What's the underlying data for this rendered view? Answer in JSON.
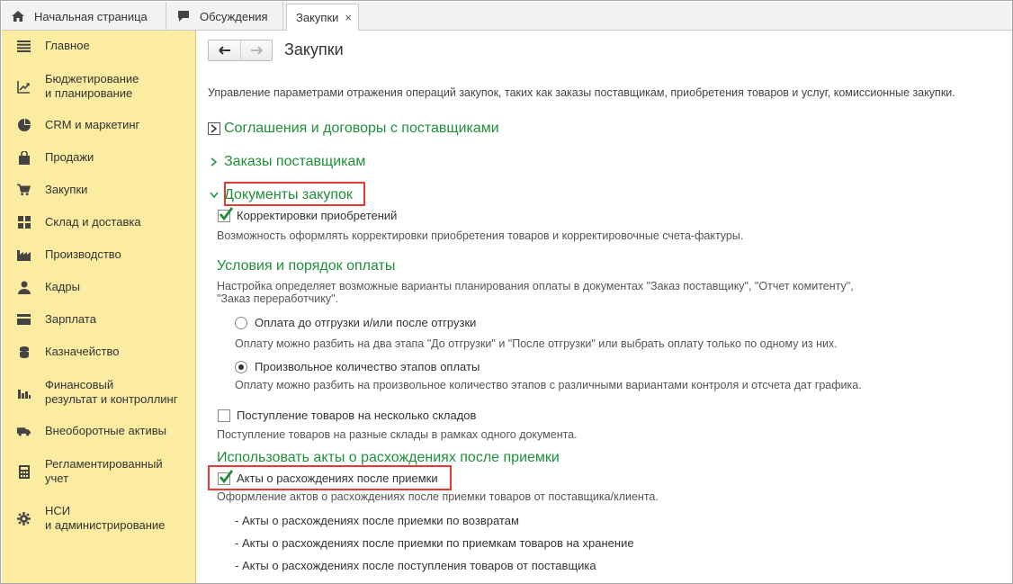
{
  "tabs": [
    {
      "label": "Начальная страница",
      "icon": "home-icon"
    },
    {
      "label": "Обсуждения",
      "icon": "discussion-icon"
    },
    {
      "label": "Закупки",
      "close": "×"
    }
  ],
  "sidebar": {
    "items": [
      {
        "label": "Главное",
        "icon": "menu-icon"
      },
      {
        "label": "Бюджетирование\nи планирование",
        "icon": "chart-growth-icon"
      },
      {
        "label": "CRM и маркетинг",
        "icon": "pie-icon"
      },
      {
        "label": "Продажи",
        "icon": "bag-icon"
      },
      {
        "label": "Закупки",
        "icon": "cart-icon"
      },
      {
        "label": "Склад и доставка",
        "icon": "warehouse-icon"
      },
      {
        "label": "Производство",
        "icon": "factory-icon"
      },
      {
        "label": "Кадры",
        "icon": "person-icon"
      },
      {
        "label": "Зарплата",
        "icon": "wallet-icon"
      },
      {
        "label": "Казначейство",
        "icon": "coins-icon"
      },
      {
        "label": "Финансовый\nрезультат и контроллинг",
        "icon": "bar-chart-icon"
      },
      {
        "label": "Внеоборотные активы",
        "icon": "truck-icon"
      },
      {
        "label": "Регламентированный\nучет",
        "icon": "calculator-icon"
      },
      {
        "label": "НСИ\nи администрирование",
        "icon": "gear-icon"
      }
    ]
  },
  "main": {
    "title": "Закупки",
    "description": "Управление параметрами отражения операций закупок, таких как заказы поставщикам, приобретения товаров и услуг, комиссионные закупки.",
    "groups": [
      {
        "label": "Соглашения и договоры с поставщиками",
        "expanded": false
      },
      {
        "label": "Заказы поставщикам",
        "expanded": false
      },
      {
        "label": "Документы закупок",
        "expanded": true
      }
    ],
    "corrections": {
      "label": "Корректировки приобретений",
      "checked": true,
      "hint": "Возможность оформлять корректировки приобретения товаров и корректировочные счета-фактуры."
    },
    "payment": {
      "heading": "Условия и порядок оплаты",
      "hint_line1": "Настройка определяет возможные варианты планирования оплаты в документах \"Заказ поставщику\", \"Отчет комитенту\",",
      "hint_line2": "\"Заказ переработчику\".",
      "options": [
        {
          "label": "Оплата до отгрузки и/или после отгрузки",
          "selected": false,
          "hint": "Оплату можно разбить на два этапа \"До отгрузки\" и \"После отгрузки\" или выбрать оплату только по одному из них."
        },
        {
          "label": "Произвольное количество этапов оплаты",
          "selected": true,
          "hint": "Оплату можно разбить на произвольное количество этапов с различными вариантами контроля и отсчета дат графика."
        }
      ]
    },
    "multi_warehouse": {
      "label": "Поступление товаров на несколько складов",
      "checked": false,
      "hint": "Поступление товаров на разные склады в рамках одного документа."
    },
    "discrepancy": {
      "heading": "Использовать акты о расхождениях после приемки",
      "label": "Акты о расхождениях после приемки",
      "checked": true,
      "hint": "Оформление актов о расхождениях после приемки товаров от поставщика/клиента.",
      "items": [
        "- Акты о расхождениях после приемки по возвратам",
        "- Акты о расхождениях после приемки по приемкам товаров на хранение",
        "- Акты о расхождениях после поступления товаров от поставщика"
      ]
    }
  },
  "colors": {
    "sidebar_bg": "#fbeca1",
    "group_green": "#1f8f3a",
    "highlight_red": "#e53935",
    "check_green": "#1f8f3a"
  }
}
